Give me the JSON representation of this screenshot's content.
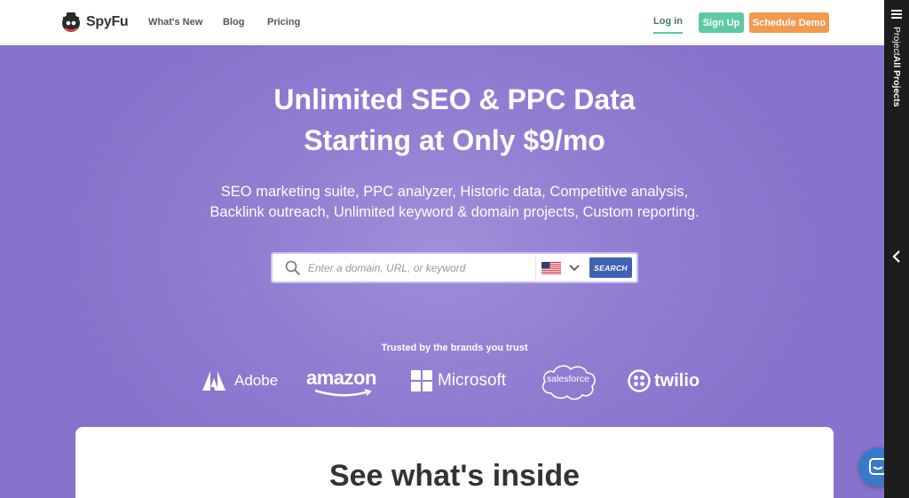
{
  "header": {
    "logo_text": "SpyFu",
    "nav": [
      "What's New",
      "Blog",
      "Pricing"
    ],
    "login": "Log in",
    "signup": "Sign Up",
    "schedule_demo": "Schedule Demo"
  },
  "hero": {
    "title_line1": "Unlimited SEO & PPC Data",
    "title_line2": "Starting at Only $9/mo",
    "subtitle_line1": "SEO marketing suite, PPC analyzer, Historic data, Competitive analysis,",
    "subtitle_line2": "Backlink outreach, Unlimited keyword & domain projects, Custom reporting."
  },
  "search": {
    "placeholder": "Enter a domain, URL, or keyword",
    "button": "SEARCH",
    "country_icon": "us-flag-icon"
  },
  "brands": {
    "heading": "Trusted by the brands you trust",
    "items": [
      "Adobe",
      "amazon",
      "Microsoft",
      "salesforce",
      "twilio"
    ]
  },
  "section": {
    "title": "See what's inside"
  },
  "sidebar": {
    "label_prefix": "Project",
    "label_bold": "All Projects"
  },
  "colors": {
    "hero_purple": "#9280d3",
    "signup_green": "#5ecaa3",
    "demo_orange": "#f39a4f",
    "search_blue": "#3f63b3",
    "chat_blue": "#3a78c9"
  }
}
